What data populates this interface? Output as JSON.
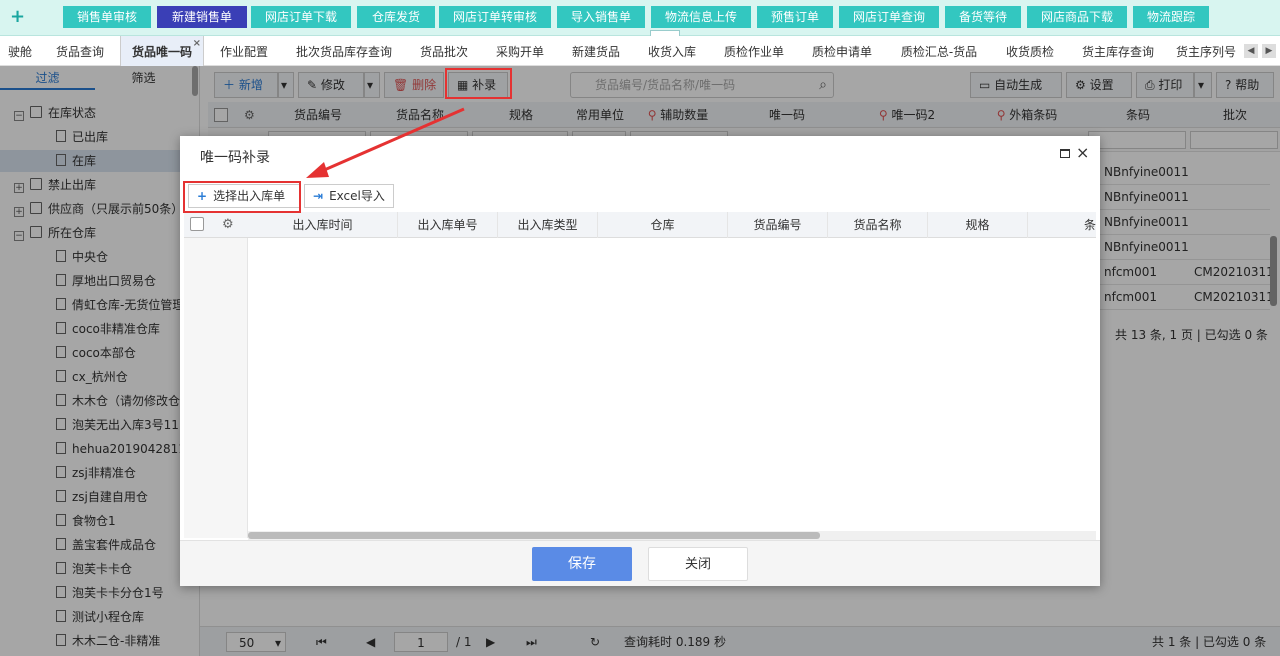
{
  "quickbar": {
    "add_icon": "plus-icon",
    "buttons": [
      "销售单审核",
      "新建销售单",
      "网店订单下载",
      "仓库发货",
      "网店订单转审核",
      "导入销售单",
      "物流信息上传",
      "预售订单",
      "网店订单查询",
      "备货等待",
      "网店商品下载",
      "物流跟踪"
    ],
    "active_index": 1,
    "accent_color": "#33c7c0",
    "active_color": "#3a3fb6"
  },
  "tabs": {
    "items": [
      "驶舱",
      "货品查询",
      "货品唯一码",
      "作业配置",
      "批次货品库存查询",
      "货品批次",
      "采购开单",
      "新建货品",
      "收货入库",
      "质检作业单",
      "质检申请单",
      "质检汇总-货品",
      "收货质检",
      "货主库存查询",
      "货主序列号"
    ],
    "active_index": 2,
    "close_glyph": "×",
    "nav_left": "◀",
    "nav_right": "▶"
  },
  "left": {
    "tabs": [
      "过滤",
      "筛选"
    ],
    "tree": [
      {
        "label": "在库状态",
        "type": "group",
        "exp": "−"
      },
      {
        "label": "已出库",
        "type": "leaf"
      },
      {
        "label": "在库",
        "type": "leaf",
        "selected": true
      },
      {
        "label": "禁止出库",
        "type": "group",
        "exp": "+"
      },
      {
        "label": "供应商（只展示前50条）",
        "type": "group",
        "exp": "+"
      },
      {
        "label": "所在仓库",
        "type": "group",
        "exp": "−"
      },
      {
        "label": "中央仓",
        "type": "leaf"
      },
      {
        "label": "厚地出口贸易仓",
        "type": "leaf"
      },
      {
        "label": "倩虹仓库-无货位管理",
        "type": "leaf"
      },
      {
        "label": "coco非精准仓库",
        "type": "leaf"
      },
      {
        "label": "coco本部仓",
        "type": "leaf"
      },
      {
        "label": "cx_杭州仓",
        "type": "leaf"
      },
      {
        "label": "木木仓（请勿修改仓",
        "type": "leaf"
      },
      {
        "label": "泡芙无出入库3号111",
        "type": "leaf"
      },
      {
        "label": "hehua2019042811",
        "type": "leaf"
      },
      {
        "label": "zsj非精准仓",
        "type": "leaf"
      },
      {
        "label": "zsj自建自用仓",
        "type": "leaf"
      },
      {
        "label": "食物仓1",
        "type": "leaf"
      },
      {
        "label": "盖宝套件成品仓",
        "type": "leaf"
      },
      {
        "label": "泡芙卡卡仓",
        "type": "leaf"
      },
      {
        "label": "泡芙卡卡分仓1号",
        "type": "leaf"
      },
      {
        "label": "测试小程仓库",
        "type": "leaf"
      },
      {
        "label": "木木二仓-非精准",
        "type": "leaf"
      }
    ]
  },
  "toolbar": {
    "add": "新增",
    "edit": "修改",
    "delete": "删除",
    "supplement": "补录",
    "search_placeholder": "货品编号/货品名称/唯一码",
    "auto_generate": "自动生成",
    "settings": "设置",
    "print": "打印",
    "help": "帮助"
  },
  "grid": {
    "columns": [
      "货品编号",
      "货品名称",
      "规格",
      "常用单位",
      "辅助数量",
      "唯一码",
      "唯一码2",
      "外箱条码",
      "条码",
      "批次"
    ],
    "rows": [
      [
        "NBnfyine0011...",
        ""
      ],
      [
        "NBnfyine0011...",
        ""
      ],
      [
        "NBnfyine0011...",
        ""
      ],
      [
        "NBnfyine0011...",
        ""
      ],
      [
        "nfcm001",
        "CM20210311"
      ],
      [
        "nfcm001",
        "CM20210311"
      ]
    ],
    "summary": "共 13 条, 1 页 | 已勾选 0 条"
  },
  "pager": {
    "page_size": "50",
    "page": "1",
    "total_pages": "/ 1",
    "query_time": "查询耗时 0.189 秒",
    "summary": "共 1 条 | 已勾选 0 条"
  },
  "dialog": {
    "title": "唯一码补录",
    "select_button": "选择出入库单",
    "excel_button": "Excel导入",
    "columns": [
      "出入库时间",
      "出入库单号",
      "出入库类型",
      "仓库",
      "货品编号",
      "货品名称",
      "规格",
      "条"
    ],
    "save": "保存",
    "close": "关闭",
    "close_glyph": "×"
  },
  "colors": {
    "highlight": "#e53232",
    "primary": "#5a8be6"
  }
}
